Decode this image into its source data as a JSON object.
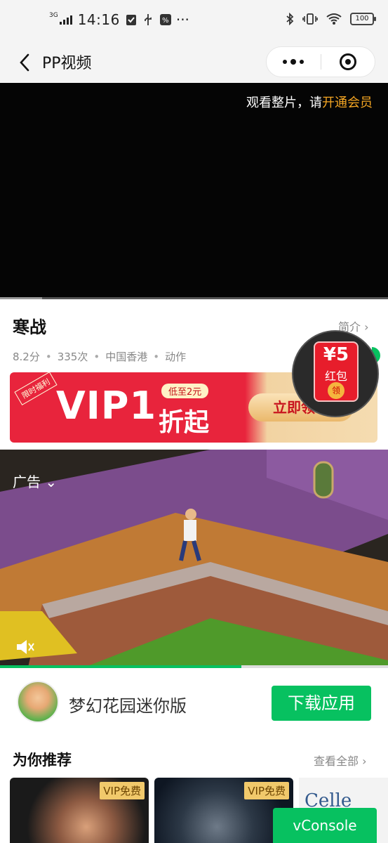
{
  "status_bar": {
    "network": "3G",
    "time": "14:16",
    "more": "···",
    "battery": "100"
  },
  "nav": {
    "title": "PP视频"
  },
  "player": {
    "message_prefix": "观看整片，请",
    "message_link": "开通会员"
  },
  "video": {
    "title": "寒战",
    "intro_link": "简介",
    "meta": [
      "8.2分",
      "335次",
      "中国香港",
      "动作"
    ]
  },
  "vip_banner": {
    "tag": "限时福利",
    "headline": "VIP1",
    "note": "低至2元",
    "fold": "折起",
    "button": "立即领取"
  },
  "red_packet": {
    "amount": "¥5",
    "label": "红包",
    "get": "领"
  },
  "ad": {
    "label": "广告"
  },
  "app": {
    "name": "梦幻花园迷你版",
    "download": "下载应用"
  },
  "recommend": {
    "title": "为你推荐",
    "more": "查看全部",
    "cards": [
      {
        "badge": "VIP免费"
      },
      {
        "badge": "VIP免费"
      },
      {
        "text": "Celle que j"
      }
    ]
  },
  "vconsole": "vConsole",
  "colors": {
    "accent_green": "#07c160",
    "vip_orange": "#f5a623",
    "banner_red": "#e8243c"
  }
}
